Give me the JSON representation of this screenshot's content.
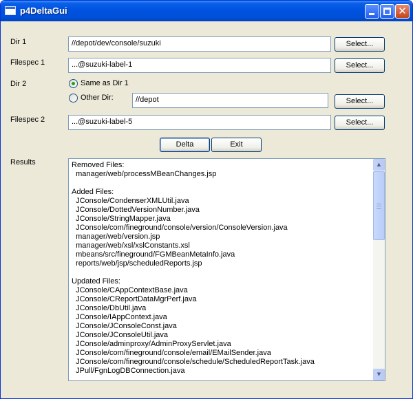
{
  "window": {
    "title": "p4DeltaGui"
  },
  "form": {
    "dir1": {
      "label": "Dir 1",
      "value": "//depot/dev/console/suzuki",
      "button": "Select..."
    },
    "filespec1": {
      "label": "Filespec 1",
      "value": "...@suzuki-label-1",
      "button": "Select..."
    },
    "dir2": {
      "label": "Dir 2",
      "option_same": "Same as Dir 1",
      "option_other": "Other Dir:",
      "selected": "same",
      "other_value": "//depot",
      "button": "Select..."
    },
    "filespec2": {
      "label": "Filespec 2",
      "value": "...@suzuki-label-5",
      "button": "Select..."
    }
  },
  "actions": {
    "delta": "Delta",
    "exit": "Exit"
  },
  "results": {
    "label": "Results",
    "text": "Removed Files:\n  manager/web/processMBeanChanges.jsp\n\nAdded Files:\n  JConsole/CondenserXMLUtil.java\n  JConsole/DottedVersionNumber.java\n  JConsole/StringMapper.java\n  JConsole/com/fineground/console/version/ConsoleVersion.java\n  manager/web/version.jsp\n  manager/web/xsl/xslConstants.xsl\n  mbeans/src/fineground/FGMBeanMetaInfo.java\n  reports/web/jsp/scheduledReports.jsp\n\nUpdated Files:\n  JConsole/CAppContextBase.java\n  JConsole/CReportDataMgrPerf.java\n  JConsole/DbUtil.java\n  JConsole/IAppContext.java\n  JConsole/JConsoleConst.java\n  JConsole/JConsoleUtil.java\n  JConsole/adminproxy/AdminProxyServlet.java\n  JConsole/com/fineground/console/email/EMailSender.java\n  JConsole/com/fineground/console/schedule/ScheduledReportTask.java\n  JPull/FgnLogDBConnection.java"
  }
}
